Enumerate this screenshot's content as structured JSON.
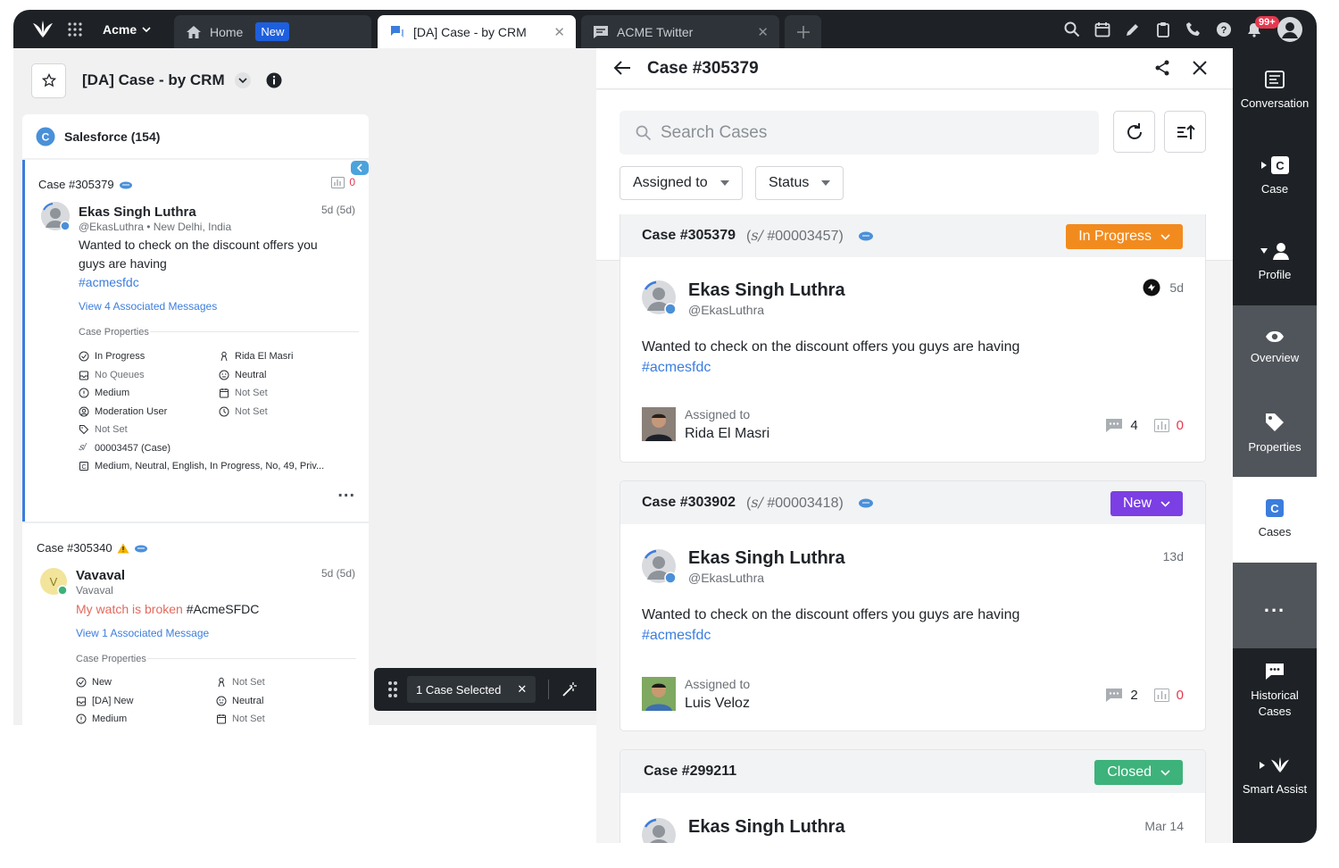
{
  "topbar": {
    "workspace": "Acme",
    "tabs": [
      {
        "label": "Home",
        "badge": "New"
      },
      {
        "label": "[DA] Case - by CRM"
      },
      {
        "label": "ACME Twitter"
      }
    ],
    "notification_count": "99+"
  },
  "left": {
    "view_title": "[DA] Case - by CRM",
    "source": "Salesforce (154)",
    "cases": [
      {
        "id": "Case #305379",
        "unread": "0",
        "name": "Ekas Singh Luthra",
        "handle": "@EkasLuthra",
        "location": "New Delhi, India",
        "age": "5d (5d)",
        "message": "Wanted to check on the discount offers you guys are having",
        "hashtag": "#acmesfdc",
        "assoc": "View 4 Associated Messages",
        "props_title": "Case Properties",
        "props": {
          "status": "In Progress",
          "assignee": "Rida El Masri",
          "queue": "No Queues",
          "sentiment": "Neutral",
          "priority": "Medium",
          "date1": "Not Set",
          "user": "Moderation User",
          "time1": "Not Set",
          "tag": "Not Set",
          "sf_case": "00003457 (Case)",
          "custom": "Medium, Neutral, English, In Progress, No, 49, Priv..."
        },
        "more": "..."
      },
      {
        "id": "Case #305340",
        "name": "Vavaval",
        "handle": "Vavaval",
        "age": "5d (5d)",
        "message_red": "My watch is broken",
        "message_rest": " #AcmeSFDC",
        "assoc": "View 1 Associated Message",
        "props_title": "Case Properties",
        "props": {
          "status": "New",
          "assignee": "Not Set",
          "queue": "[DA] New",
          "sentiment": "Neutral",
          "priority": "Medium",
          "date1": "Not Set"
        }
      }
    ],
    "selection": "1 Case Selected"
  },
  "right": {
    "title": "Case #305379",
    "search_placeholder": "Search Cases",
    "filters": {
      "assigned": "Assigned to",
      "status": "Status"
    },
    "cases": [
      {
        "id": "Case #305379",
        "sf_id": "#00003457)",
        "sf_prefix": "(",
        "status": "In Progress",
        "status_color": "#f28b1e",
        "name": "Ekas Singh Luthra",
        "handle": "@EkasLuthra",
        "age": "5d",
        "message": "Wanted to check on the discount offers you guys are having",
        "hashtag": "#acmesfdc",
        "assigned_label": "Assigned to",
        "assignee": "Rida El Masri",
        "msg_count": "4",
        "unread": "0"
      },
      {
        "id": "Case #303902",
        "sf_id": "#00003418)",
        "sf_prefix": "(",
        "status": "New",
        "status_color": "#7b3fe4",
        "name": "Ekas Singh Luthra",
        "handle": "@EkasLuthra",
        "age": "13d",
        "message": "Wanted to check on the discount offers you guys are having",
        "hashtag": "#acmesfdc",
        "assigned_label": "Assigned to",
        "assignee": "Luis Veloz",
        "msg_count": "2",
        "unread": "0"
      },
      {
        "id": "Case #299211",
        "status": "Closed",
        "status_color": "#3db27a",
        "name": "Ekas Singh Luthra",
        "age": "Mar 14"
      }
    ]
  },
  "rail": {
    "items": [
      "Conversation",
      "Case",
      "Profile",
      "Overview",
      "Properties",
      "Cases",
      "...",
      "Historical Cases",
      "Smart Assist"
    ]
  }
}
